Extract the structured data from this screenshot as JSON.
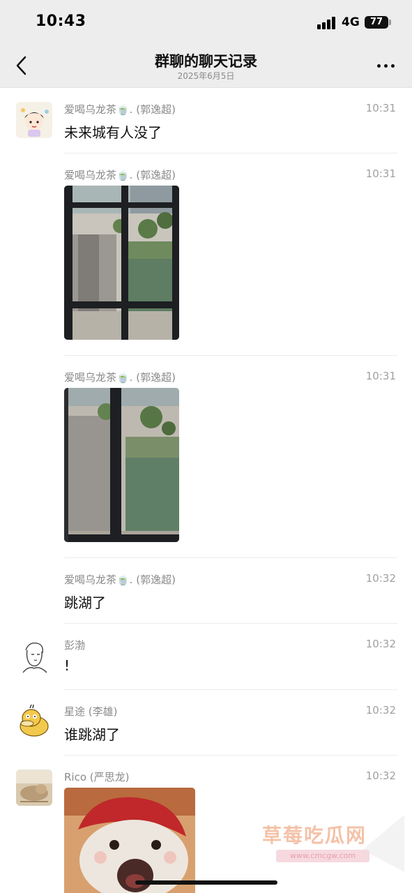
{
  "status_bar": {
    "time": "10:43",
    "network": "4G",
    "battery": "77"
  },
  "header": {
    "title": "群聊的聊天记录",
    "subtitle": "2025年6月5日",
    "back_icon": "chevron-left-icon",
    "more_icon": "more-dots-icon"
  },
  "messages": [
    {
      "sender": "爱喝乌龙茶🍵. (郭逸超)",
      "time": "10:31",
      "text": "未来城有人没了"
    },
    {
      "sender": "爱喝乌龙茶🍵. (郭逸超)",
      "time": "10:31",
      "image": "photo of road and canal through window"
    },
    {
      "sender": "爱喝乌龙茶🍵. (郭逸超)",
      "time": "10:31",
      "image": "photo of canal through window"
    },
    {
      "sender": "爱喝乌龙茶🍵. (郭逸超)",
      "time": "10:32",
      "text": "跳湖了"
    },
    {
      "sender": "彭渤",
      "time": "10:32",
      "text": "!"
    },
    {
      "sender": "星途 (李雄)",
      "time": "10:32",
      "text": "谁跳湖了"
    },
    {
      "sender": "Rico (严思龙)",
      "time": "10:32",
      "image": "sticker image"
    }
  ],
  "watermark": {
    "text": "草莓吃瓜网",
    "url": "www.cmcgw.com"
  }
}
